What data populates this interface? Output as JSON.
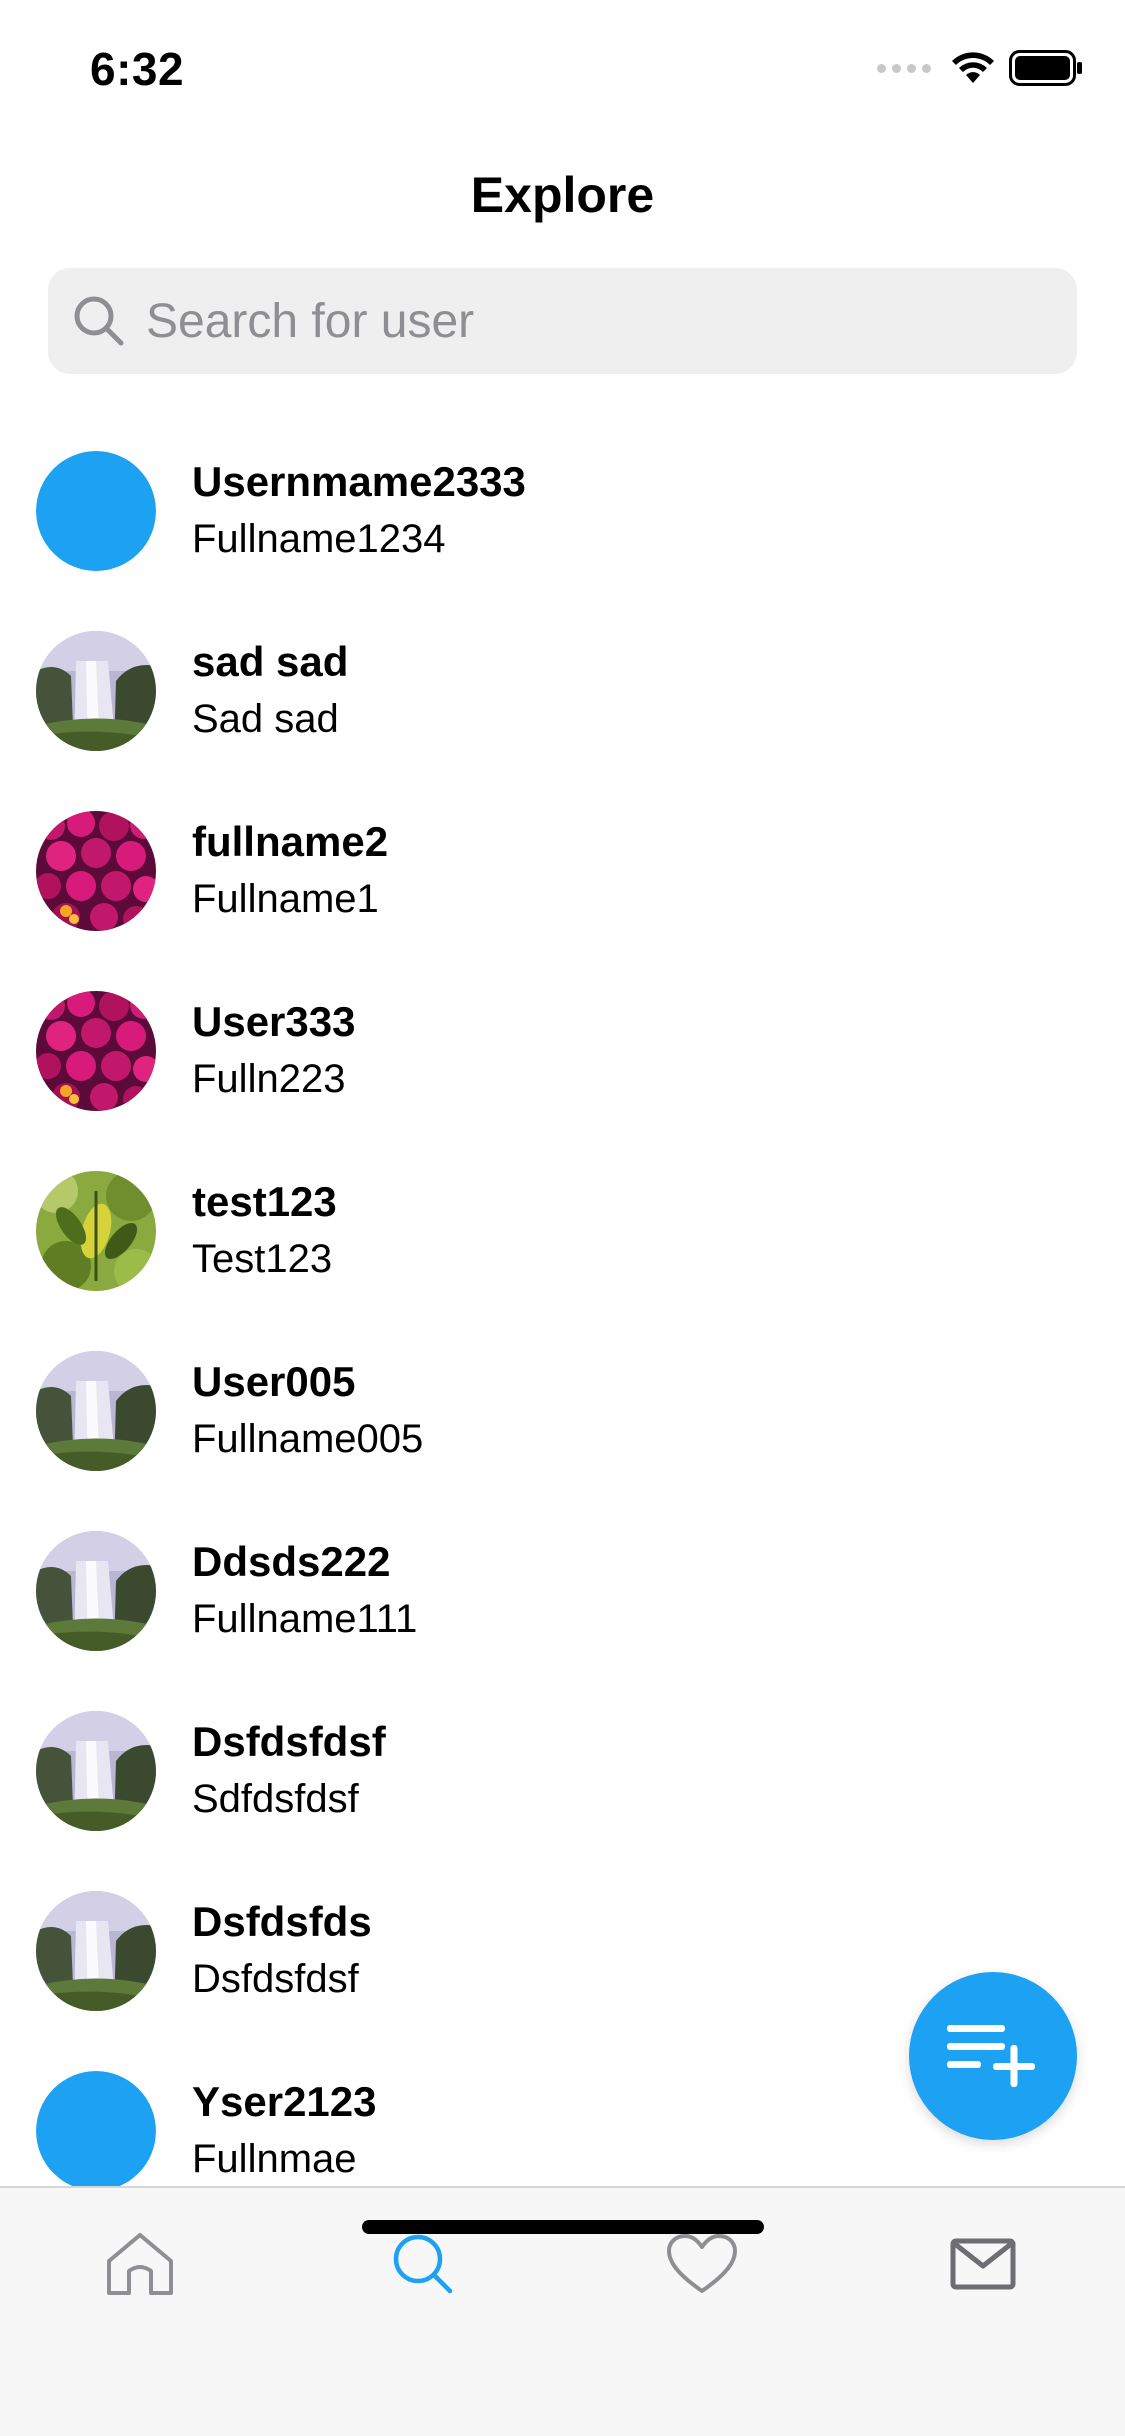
{
  "status_bar": {
    "time": "6:32"
  },
  "header": {
    "title": "Explore"
  },
  "search": {
    "placeholder": "Search for user",
    "value": ""
  },
  "users": [
    {
      "username": "Usernmame2333",
      "fullname": "Fullname1234",
      "avatar": "blue-circle"
    },
    {
      "username": "sad sad",
      "fullname": "Sad sad",
      "avatar": "waterfall-photo"
    },
    {
      "username": "fullname2",
      "fullname": "Fullname1",
      "avatar": "flowers-photo"
    },
    {
      "username": "User333",
      "fullname": "Fulln223",
      "avatar": "flowers-photo"
    },
    {
      "username": "test123",
      "fullname": "Test123",
      "avatar": "leaves-photo"
    },
    {
      "username": "User005",
      "fullname": "Fullname005",
      "avatar": "waterfall-photo"
    },
    {
      "username": "Ddsds222",
      "fullname": "Fullname111",
      "avatar": "waterfall-photo"
    },
    {
      "username": "Dsfdsfdsf",
      "fullname": "Sdfdsfdsf",
      "avatar": "waterfall-photo"
    },
    {
      "username": "Dsfdsfds",
      "fullname": "Dsfdsfdsf",
      "avatar": "waterfall-photo"
    },
    {
      "username": "Yser2123",
      "fullname": "Fullnmae",
      "avatar": "blue-circle"
    }
  ],
  "fab": {
    "icon": "new-list-plus-icon"
  },
  "tabs": [
    {
      "name": "home",
      "icon": "home-icon",
      "active": false
    },
    {
      "name": "search",
      "icon": "search-icon",
      "active": true
    },
    {
      "name": "likes",
      "icon": "heart-icon",
      "active": false
    },
    {
      "name": "messages",
      "icon": "mail-icon",
      "active": false
    }
  ],
  "colors": {
    "accent": "#1da1f2",
    "inactive_tab": "#8e8e93",
    "search_bg": "#efefef",
    "tab_bar_bg": "#f7f7f7"
  }
}
